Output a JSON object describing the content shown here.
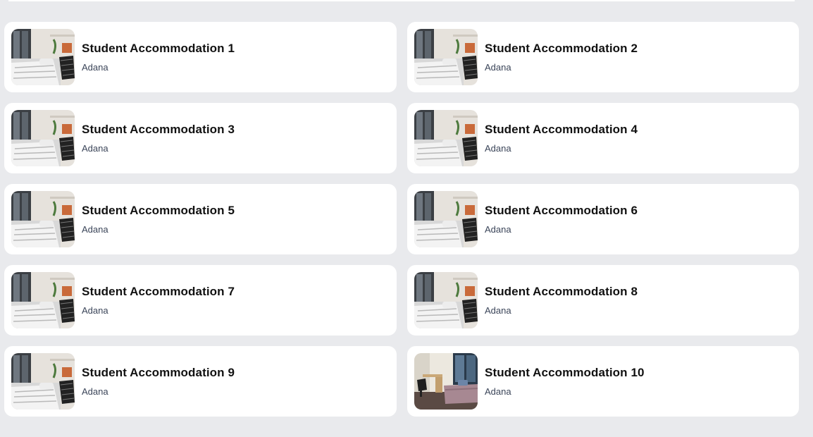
{
  "listings": [
    {
      "title": "Student Accommodation 1",
      "location": "Adana",
      "image": "room-white-icon"
    },
    {
      "title": "Student Accommodation 2",
      "location": "Adana",
      "image": "room-white-icon"
    },
    {
      "title": "Student Accommodation 3",
      "location": "Adana",
      "image": "room-white-icon"
    },
    {
      "title": "Student Accommodation 4",
      "location": "Adana",
      "image": "room-white-icon"
    },
    {
      "title": "Student Accommodation 5",
      "location": "Adana",
      "image": "room-white-icon"
    },
    {
      "title": "Student Accommodation 6",
      "location": "Adana",
      "image": "room-white-icon"
    },
    {
      "title": "Student Accommodation 7",
      "location": "Adana",
      "image": "room-white-icon"
    },
    {
      "title": "Student Accommodation 8",
      "location": "Adana",
      "image": "room-white-icon"
    },
    {
      "title": "Student Accommodation 9",
      "location": "Adana",
      "image": "room-white-icon"
    },
    {
      "title": "Student Accommodation 10",
      "location": "Adana",
      "image": "room-desk-icon"
    }
  ],
  "colors": {
    "background": "#e9eaed",
    "card": "#ffffff",
    "title": "#111111",
    "location": "#3a4458"
  }
}
